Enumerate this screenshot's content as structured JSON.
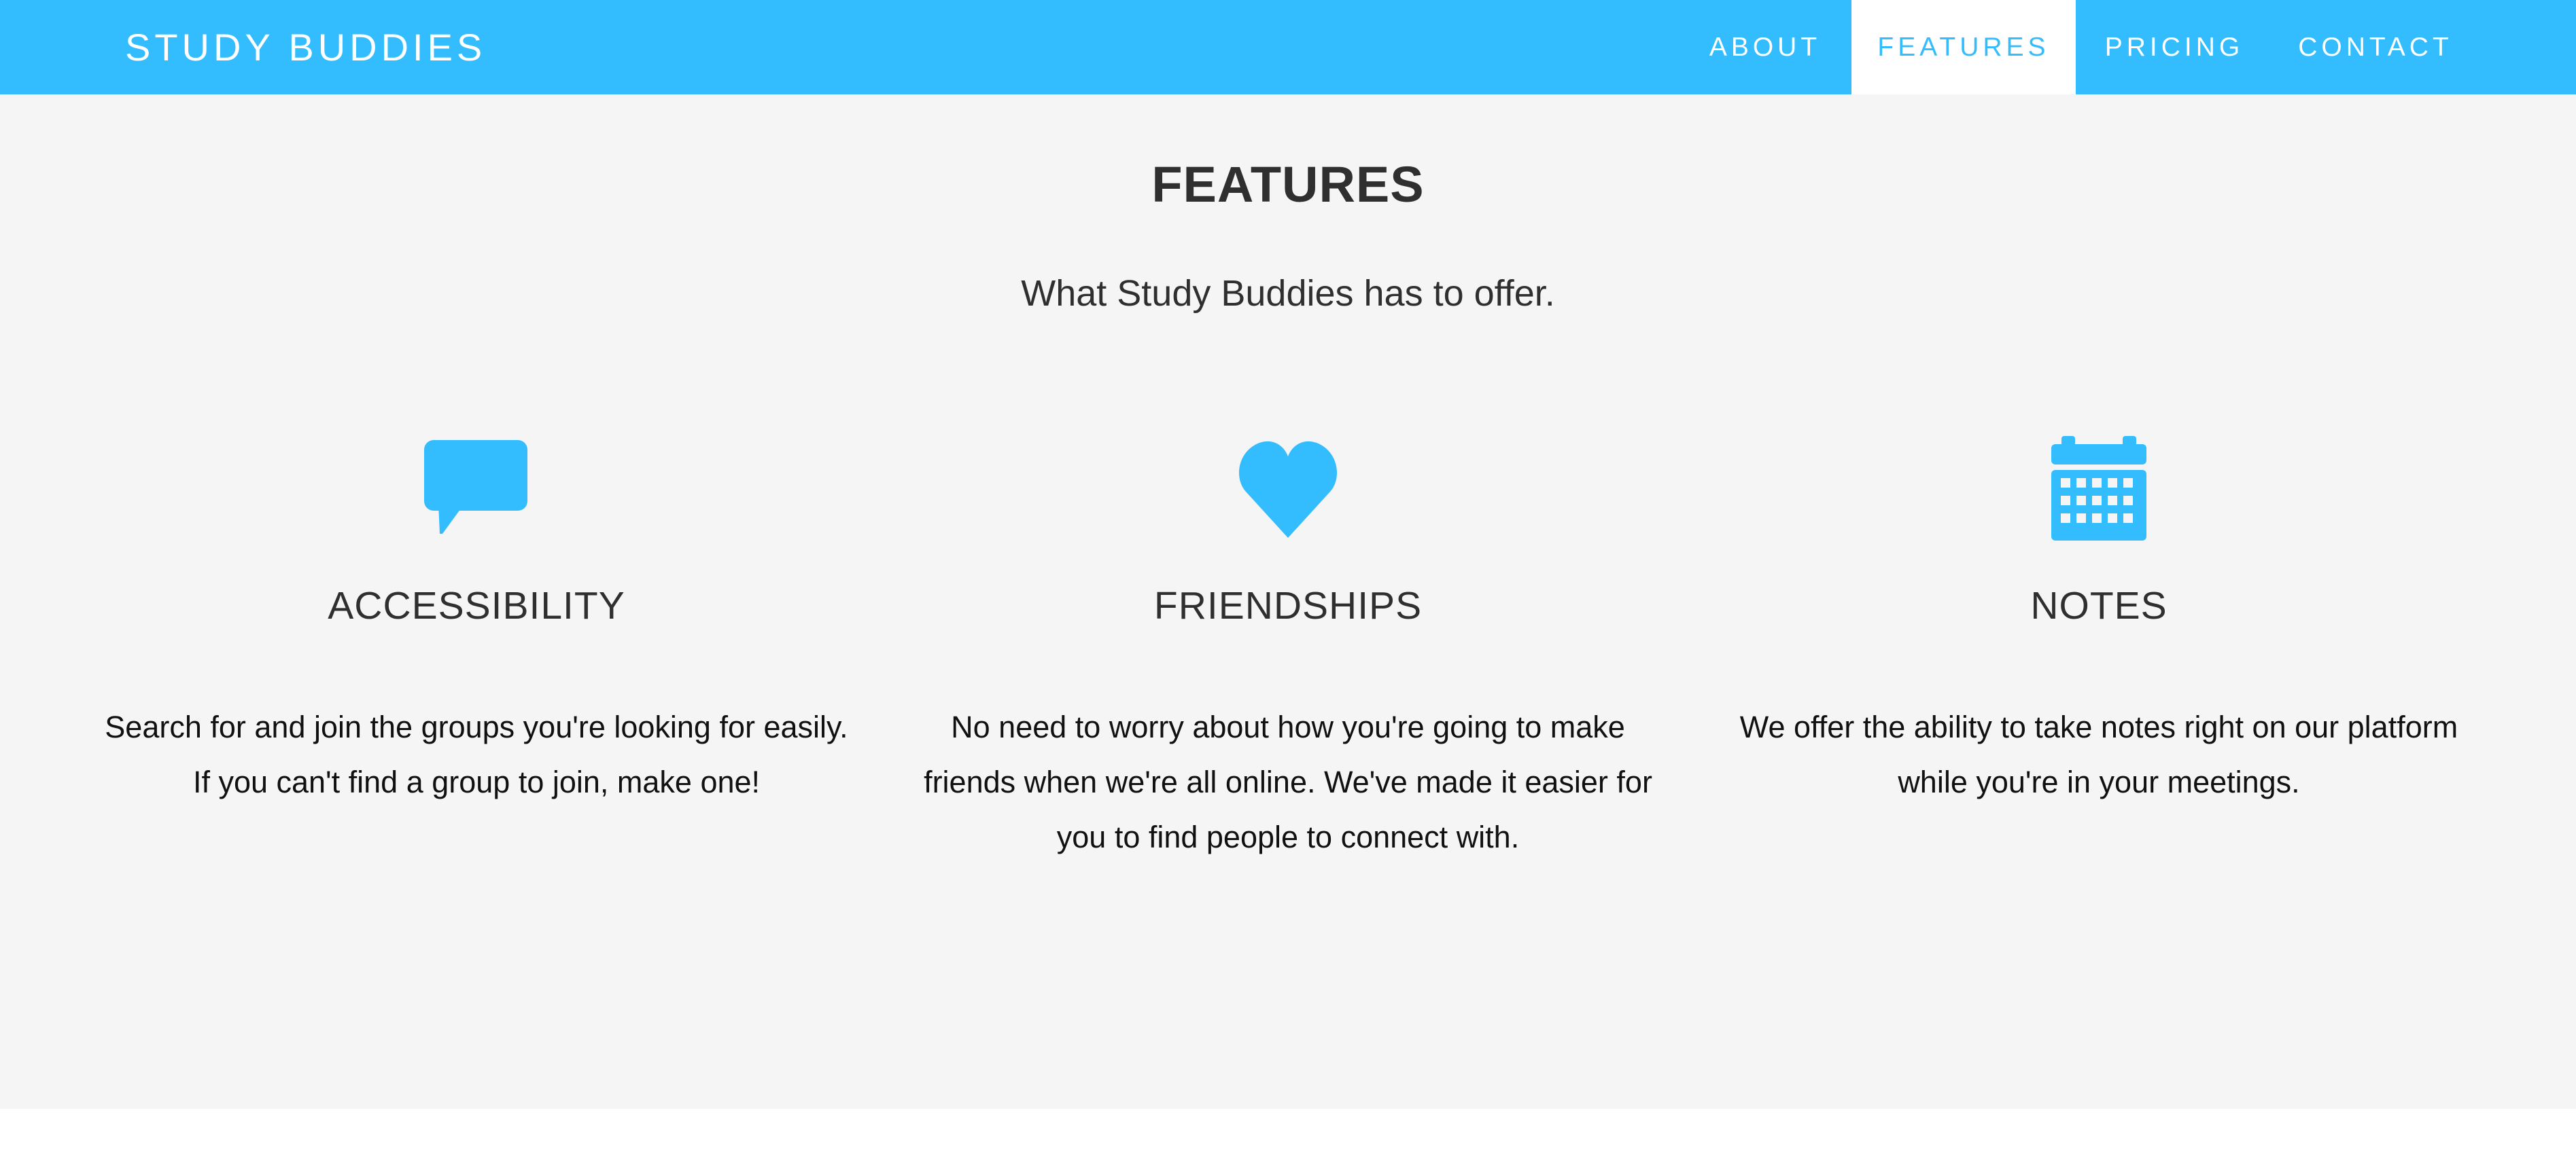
{
  "brand": "STUDY BUDDIES",
  "nav": {
    "about": "ABOUT",
    "features": "FEATURES",
    "pricing": "PRICING",
    "contact": "CONTACT"
  },
  "section": {
    "title": "FEATURES",
    "subtitle": "What Study Buddies has to offer."
  },
  "features": [
    {
      "icon": "comment-icon",
      "title": "ACCESSIBILITY",
      "text": "Search for and join the groups you're looking for easily. If you can't find a group to join, make one!"
    },
    {
      "icon": "heart-icon",
      "title": "FRIENDSHIPS",
      "text": "No need to worry about how you're going to make friends when we're all online. We've made it easier for you to find people to connect with."
    },
    {
      "icon": "calendar-icon",
      "title": "NOTES",
      "text": "We offer the ability to take notes right on our platform while you're in your meetings."
    }
  ],
  "colors": {
    "accent": "#33bdfe",
    "section_bg": "#f5f5f5",
    "heading": "#2f2f2f"
  }
}
